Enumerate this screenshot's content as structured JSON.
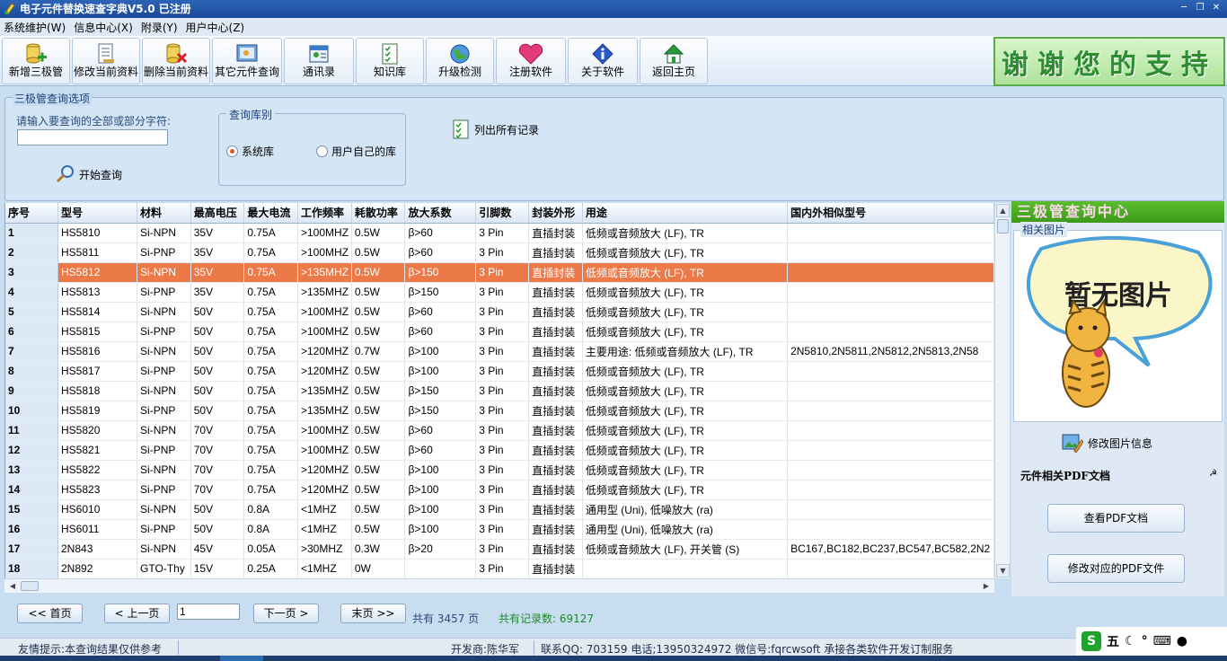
{
  "window": {
    "title": "电子元件替换速查字典V5.0 已注册"
  },
  "menu": [
    {
      "label": "系统维护(W)"
    },
    {
      "label": "信息中心(X)"
    },
    {
      "label": "附录(Y)"
    },
    {
      "label": "用户中心(Z)"
    }
  ],
  "toolbar": [
    {
      "label": "新增三极管",
      "icon": "add-transistor-icon"
    },
    {
      "label": "修改当前资料",
      "icon": "edit-record-icon"
    },
    {
      "label": "删除当前资料",
      "icon": "delete-record-icon"
    },
    {
      "label": "其它元件查询",
      "icon": "other-components-icon"
    },
    {
      "label": "通讯录",
      "icon": "contacts-icon"
    },
    {
      "label": "知识库",
      "icon": "knowledge-base-icon"
    },
    {
      "label": "升级检测",
      "icon": "upgrade-globe-icon"
    },
    {
      "label": "注册软件",
      "icon": "heart-icon"
    },
    {
      "label": "关于软件",
      "icon": "info-icon"
    },
    {
      "label": "返回主页",
      "icon": "home-icon"
    }
  ],
  "banner": {
    "text": "谢谢您的支持"
  },
  "query": {
    "legend": "三极管查询选项",
    "prompt": "请输入要查询的全部或部分字符:",
    "input_value": "",
    "start_label": "开始查询",
    "library_legend": "查询库别",
    "library_options": [
      {
        "label": "系统库",
        "selected": true
      },
      {
        "label": "用户自己的库",
        "selected": false
      }
    ],
    "list_all_label": "列出所有记录"
  },
  "grid": {
    "columns": [
      "序号",
      "型号",
      "材料",
      "最高电压",
      "最大电流",
      "工作频率",
      "耗散功率",
      "放大系数",
      "引脚数",
      "封装外形",
      "用途",
      "国内外相似型号"
    ],
    "selected_row": 3,
    "rows": [
      [
        "1",
        "HS5810",
        "Si-NPN",
        "35V",
        "0.75A",
        ">100MHZ",
        "0.5W",
        "β>60",
        "3 Pin",
        "直插封装",
        "低频或音频放大 (LF), TR",
        ""
      ],
      [
        "2",
        "HS5811",
        "Si-PNP",
        "35V",
        "0.75A",
        ">100MHZ",
        "0.5W",
        "β>60",
        "3 Pin",
        "直插封装",
        "低频或音频放大 (LF), TR",
        ""
      ],
      [
        "3",
        "HS5812",
        "Si-NPN",
        "35V",
        "0.75A",
        ">135MHZ",
        "0.5W",
        "β>150",
        "3 Pin",
        "直插封装",
        "低频或音频放大 (LF), TR",
        ""
      ],
      [
        "4",
        "HS5813",
        "Si-PNP",
        "35V",
        "0.75A",
        ">135MHZ",
        "0.5W",
        "β>150",
        "3 Pin",
        "直插封装",
        "低频或音频放大 (LF), TR",
        ""
      ],
      [
        "5",
        "HS5814",
        "Si-NPN",
        "50V",
        "0.75A",
        ">100MHZ",
        "0.5W",
        "β>60",
        "3 Pin",
        "直插封装",
        "低频或音频放大 (LF), TR",
        ""
      ],
      [
        "6",
        "HS5815",
        "Si-PNP",
        "50V",
        "0.75A",
        ">100MHZ",
        "0.5W",
        "β>60",
        "3 Pin",
        "直插封装",
        "低频或音频放大 (LF), TR",
        ""
      ],
      [
        "7",
        "HS5816",
        "Si-NPN",
        "50V",
        "0.75A",
        ">120MHZ",
        "0.7W",
        "β>100",
        "3 Pin",
        "直插封装",
        "主要用途: 低频或音频放大 (LF), TR",
        "2N5810,2N5811,2N5812,2N5813,2N58"
      ],
      [
        "8",
        "HS5817",
        "Si-PNP",
        "50V",
        "0.75A",
        ">120MHZ",
        "0.5W",
        "β>100",
        "3 Pin",
        "直插封装",
        "低频或音频放大 (LF), TR",
        ""
      ],
      [
        "9",
        "HS5818",
        "Si-NPN",
        "50V",
        "0.75A",
        ">135MHZ",
        "0.5W",
        "β>150",
        "3 Pin",
        "直插封装",
        "低频或音频放大 (LF), TR",
        ""
      ],
      [
        "10",
        "HS5819",
        "Si-PNP",
        "50V",
        "0.75A",
        ">135MHZ",
        "0.5W",
        "β>150",
        "3 Pin",
        "直插封装",
        "低频或音频放大 (LF), TR",
        ""
      ],
      [
        "11",
        "HS5820",
        "Si-NPN",
        "70V",
        "0.75A",
        ">100MHZ",
        "0.5W",
        "β>60",
        "3 Pin",
        "直插封装",
        "低频或音频放大 (LF), TR",
        ""
      ],
      [
        "12",
        "HS5821",
        "Si-PNP",
        "70V",
        "0.75A",
        ">100MHZ",
        "0.5W",
        "β>60",
        "3 Pin",
        "直插封装",
        "低频或音频放大 (LF), TR",
        ""
      ],
      [
        "13",
        "HS5822",
        "Si-NPN",
        "70V",
        "0.75A",
        ">120MHZ",
        "0.5W",
        "β>100",
        "3 Pin",
        "直插封装",
        "低频或音频放大 (LF), TR",
        ""
      ],
      [
        "14",
        "HS5823",
        "Si-PNP",
        "70V",
        "0.75A",
        ">120MHZ",
        "0.5W",
        "β>100",
        "3 Pin",
        "直插封装",
        "低频或音频放大 (LF), TR",
        ""
      ],
      [
        "15",
        "HS6010",
        "Si-NPN",
        "50V",
        "0.8A",
        "<1MHZ",
        "0.5W",
        "β>100",
        "3 Pin",
        "直插封装",
        "通用型 (Uni), 低噪放大 (ra)",
        ""
      ],
      [
        "16",
        "HS6011",
        "Si-PNP",
        "50V",
        "0.8A",
        "<1MHZ",
        "0.5W",
        "β>100",
        "3 Pin",
        "直插封装",
        "通用型 (Uni), 低噪放大 (ra)",
        ""
      ],
      [
        "17",
        "2N843",
        "Si-NPN",
        "45V",
        "0.05A",
        ">30MHZ",
        "0.3W",
        "β>20",
        "3 Pin",
        "直插封装",
        "低频或音频放大 (LF), 开关管 (S)",
        "BC167,BC182,BC237,BC547,BC582,2N2"
      ],
      [
        "18",
        "2N892",
        "GTO-Thy",
        "15V",
        "0.25A",
        "<1MHZ",
        "0W",
        "",
        "3 Pin",
        "直插封装",
        "",
        ""
      ]
    ]
  },
  "side": {
    "header": "三极管查询中心",
    "picture_legend": "相关图片",
    "picture_text": "暂无图片",
    "edit_picture_label": "修改图片信息",
    "pdf_header": "元件相关PDF文档",
    "view_pdf_label": "查看PDF文档",
    "edit_pdf_label": "修改对应的PDF文件"
  },
  "pager": {
    "first_label": "<< 首页",
    "prev_label": "< 上一页",
    "page_value": "1",
    "next_label": "下一页 >",
    "last_label": "末页 >>",
    "total_pages_text": "共有 3457 页",
    "total_records_text": "共有记录数: 69127"
  },
  "status": {
    "tip": "友情提示:本查询结果仅供参考",
    "developer": "开发商:陈华军",
    "contact": "联系QQ: 703159 电话;13950324972 微信号:fqrcwsoft  承接各类软件开发订制服务"
  },
  "ime": {
    "label": "五"
  },
  "colors": {
    "selected_row": "#ec7a48",
    "banner_green": "#2d8c34",
    "title_blue": "#1a4a98"
  }
}
